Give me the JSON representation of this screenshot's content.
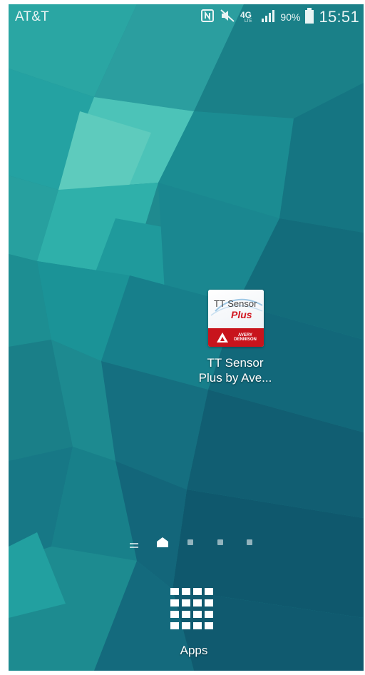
{
  "status_bar": {
    "carrier": "AT&T",
    "battery_percent": "90%",
    "time": "15:51",
    "network_label": "4G",
    "icons": [
      "nfc-icon",
      "mute-icon",
      "4g-lte-icon",
      "signal-icon",
      "battery-icon"
    ]
  },
  "home": {
    "shortcut": {
      "label_line1": "TT Sensor",
      "label_line2": "Plus by Ave...",
      "icon_text_top": "TT Sensor",
      "icon_text_plus": "Plus",
      "icon_brand": "AVERY DENNISON"
    },
    "page_indicator": {
      "pages": [
        "menu",
        "home",
        "dot",
        "dot",
        "dot"
      ],
      "current_index": 1
    },
    "apps_label": "Apps"
  },
  "colors": {
    "wallpaper_base": "#1f8a8f",
    "brand_red": "#c8141c"
  }
}
